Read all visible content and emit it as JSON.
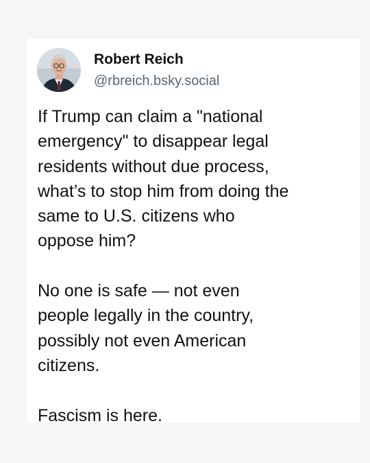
{
  "post": {
    "author": {
      "name": "Robert Reich",
      "handle": "@rbreich.bsky.social",
      "avatar_icon": "profile-photo"
    },
    "paragraphs": [
      {
        "lines": [
          "If Trump can claim a \"national",
          "emergency\" to disappear legal",
          "residents without due process,",
          "what’s to stop him from doing the",
          "same to U.S. citizens who",
          "oppose him?"
        ]
      },
      {
        "lines": [
          "No one is safe — not even",
          "people legally in the country,",
          "possibly not even American",
          "citizens."
        ]
      },
      {
        "lines": [
          "Fascism is here."
        ]
      }
    ]
  },
  "colors": {
    "background": "#f6f6f6",
    "card": "#ffffff",
    "text": "#111111",
    "handle": "#5b6470"
  }
}
